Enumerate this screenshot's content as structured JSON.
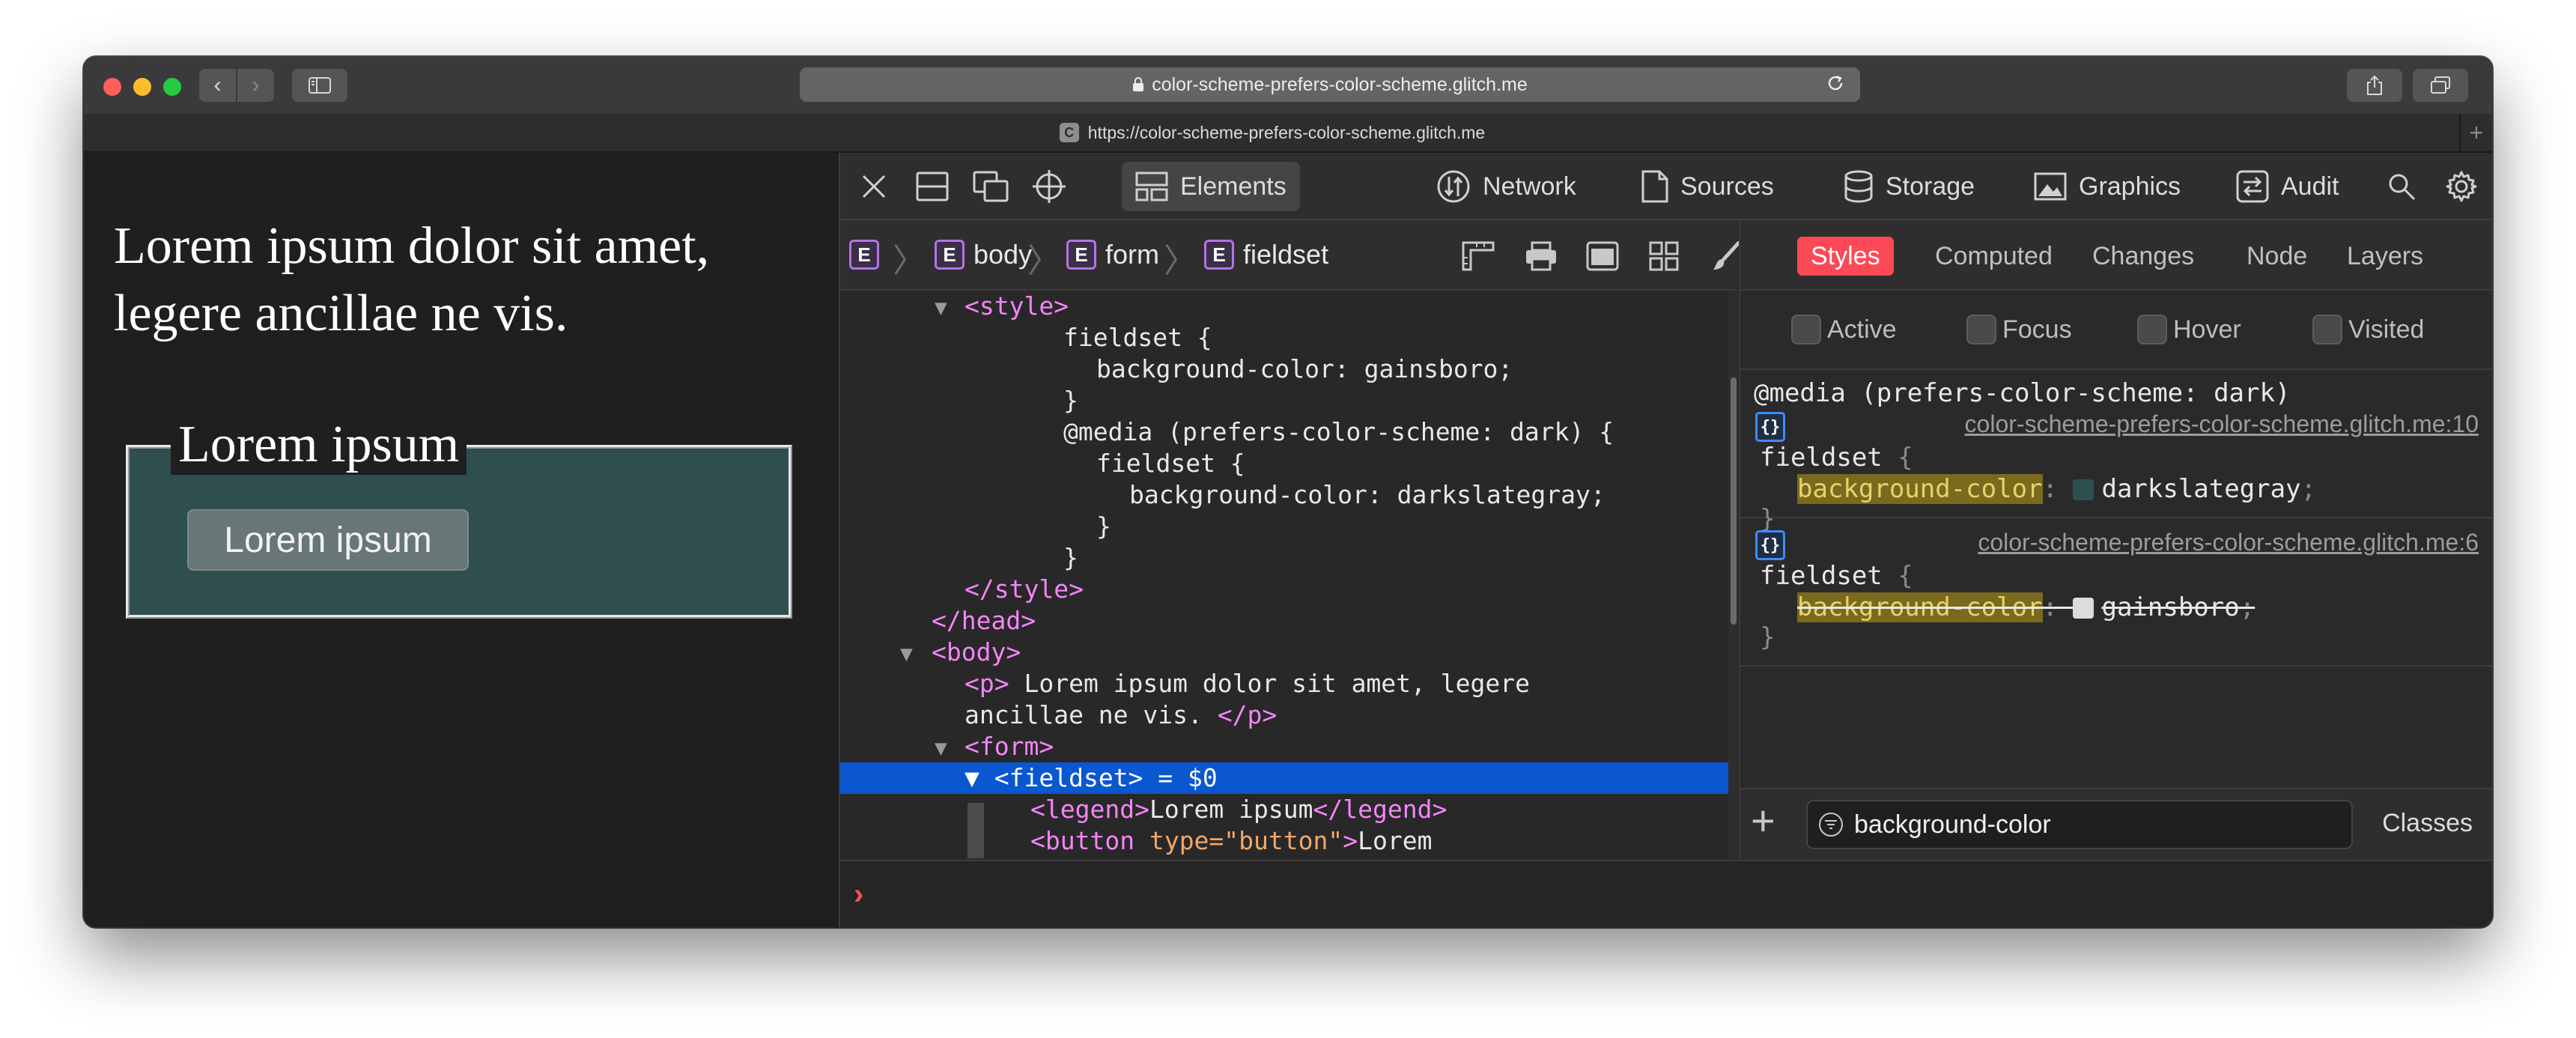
{
  "browser": {
    "address": "color-scheme-prefers-color-scheme.glitch.me",
    "tab_favicon": "C",
    "tab_title": "https://color-scheme-prefers-color-scheme.glitch.me",
    "traffic_colors": [
      "#fe5f57",
      "#febc2e",
      "#28c840"
    ]
  },
  "page": {
    "paragraph": "Lorem ipsum dolor sit amet, legere ancillae ne vis.",
    "legend": "Lorem ipsum",
    "button": "Lorem ipsum",
    "fieldset_color": "#2f4f4f"
  },
  "devtools": {
    "tabs": [
      {
        "label": "Elements",
        "icon": "elements-icon",
        "active": true
      },
      {
        "label": "Network",
        "icon": "network-icon"
      },
      {
        "label": "Sources",
        "icon": "sources-icon"
      },
      {
        "label": "Storage",
        "icon": "storage-icon"
      },
      {
        "label": "Graphics",
        "icon": "graphics-icon"
      },
      {
        "label": "Audit",
        "icon": "audit-icon"
      }
    ],
    "more": "»",
    "breadcrumb": [
      {
        "badge": "E",
        "label": ""
      },
      {
        "badge": "E",
        "label": "body"
      },
      {
        "badge": "E",
        "label": "form"
      },
      {
        "badge": "E",
        "label": "fieldset"
      }
    ],
    "dom": {
      "l1_tag": "<style>",
      "l2": "fieldset {",
      "l3": "background-color: gainsboro;",
      "l4": "}",
      "l5": "@media (prefers-color-scheme: dark) {",
      "l6": "fieldset {",
      "l7": "background-color: darkslategray;",
      "l8": "}",
      "l9": "}",
      "l10": "</style>",
      "l11": "</head>",
      "l12": "<body>",
      "l13_open": "<p>",
      "l13_text": " Lorem ipsum dolor sit amet, legere",
      "l14_text": "ancillae ne vis. ",
      "l14_close": "</p>",
      "l15": "<form>",
      "l16_tag": "<fieldset>",
      "l16_tail": " = $0",
      "l17_open": "<legend>",
      "l17_text": "Lorem ipsum",
      "l17_close": "</legend>",
      "l18_open": "<button ",
      "l18_attr": "type=",
      "l18_val": "\"button\"",
      "l18_close": ">",
      "l18_text": "Lorem"
    },
    "sidebar": {
      "tabs": [
        "Styles",
        "Computed",
        "Changes",
        "Node",
        "Layers"
      ],
      "pseudo": [
        "Active",
        "Focus",
        "Hover",
        "Visited"
      ],
      "rule1": {
        "media": "@media (prefers-color-scheme: dark)",
        "source": "color-scheme-prefers-color-scheme.glitch.me:10",
        "selector": "fieldset",
        "open": " {",
        "prop": "background-color",
        "colon": ":",
        "value": "darkslategray",
        "semi": ";",
        "close": "}",
        "swatch": "#2f4f4f"
      },
      "rule2": {
        "source": "color-scheme-prefers-color-scheme.glitch.me:6",
        "selector": "fieldset",
        "open": " {",
        "prop": "background-color",
        "colon": ":",
        "value": "gainsboro",
        "semi": ";",
        "close": "}",
        "swatch": "#dcdcdc"
      },
      "filter_value": "background-color",
      "classes": "Classes"
    },
    "console_prompt": "›"
  }
}
